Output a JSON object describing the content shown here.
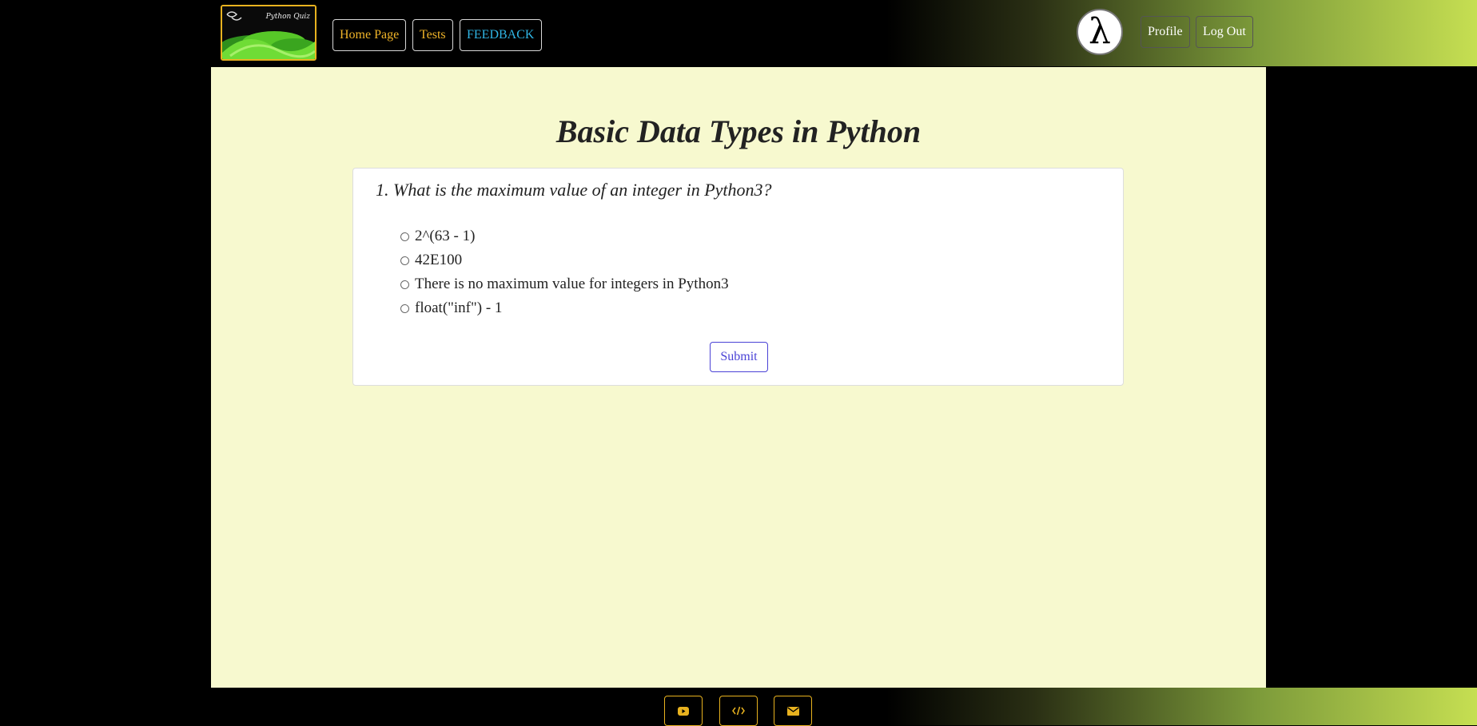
{
  "header": {
    "logo_text": "Python Quiz",
    "nav": {
      "home": "Home Page",
      "tests": "Tests",
      "feedback": "FEEDBACK"
    },
    "avatar_symbol": "λ",
    "profile": "Profile",
    "logout": "Log Out"
  },
  "quiz": {
    "title": "Basic Data Types in Python",
    "question": "1. What is the maximum value of an integer in Python3?",
    "options": [
      "2^(63 - 1)",
      "42E100",
      "There is no maximum value for integers in Python3",
      "float(\"inf\") - 1"
    ],
    "submit": "Submit"
  },
  "footer": {
    "icons": [
      "youtube-icon",
      "code-icon",
      "envelope-icon"
    ]
  },
  "colors": {
    "accent_gold": "#e8b21f",
    "feedback_blue": "#30b6e6",
    "content_bg": "#f7f9cf",
    "submit_blue": "#4a42d6",
    "gradient_end": "#c6df52"
  }
}
